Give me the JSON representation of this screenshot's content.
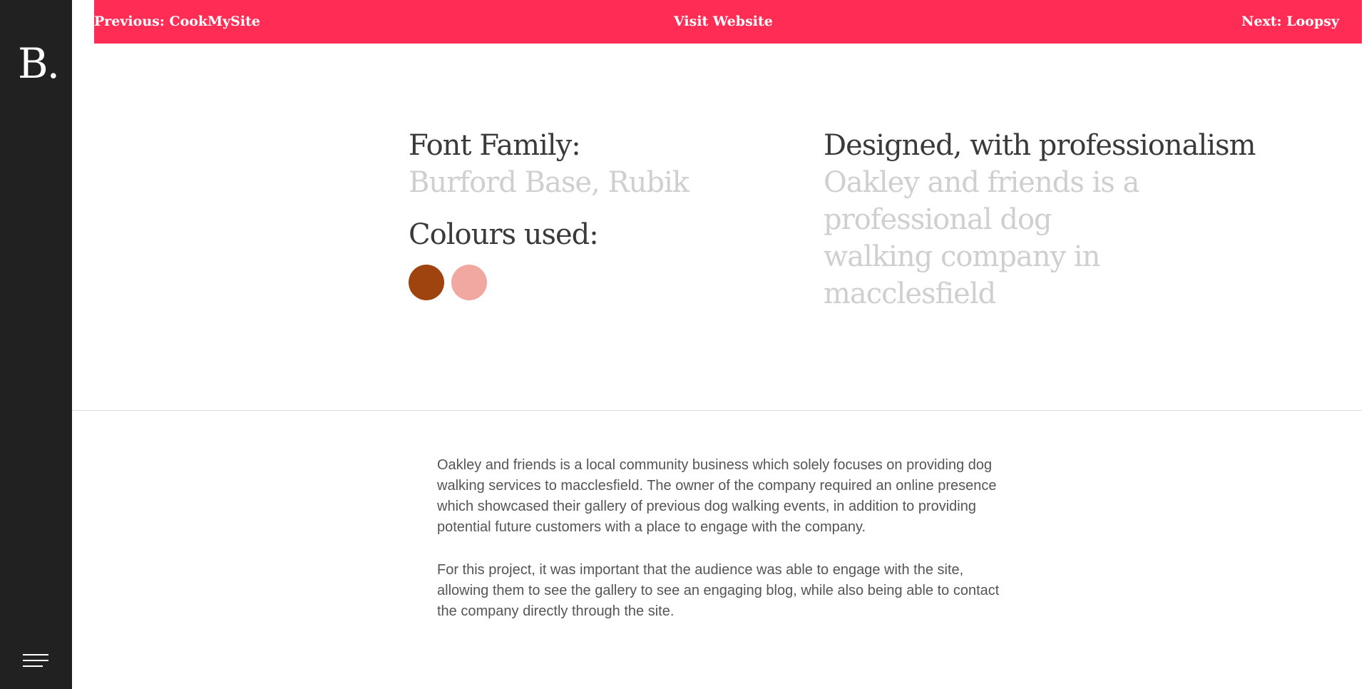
{
  "sidebar": {
    "logo": "B."
  },
  "topbar": {
    "previous_label": "Previous: CookMySite",
    "visit_label": "Visit Website",
    "next_label": "Next: Loopsy"
  },
  "details": {
    "font_family_heading": "Font Family:",
    "font_family_value": "Burford Base, Rubik",
    "colours_heading": "Colours used:",
    "colours": [
      "#a0440f",
      "#f0a8a0"
    ],
    "design_heading": "Designed, with professionalism",
    "design_lines": [
      "Oakley and friends is a",
      "professional dog",
      "walking company in",
      "macclesfield"
    ]
  },
  "description": {
    "paragraph1_lines": [
      "Oakley and friends is a local community business which solely focuses on providing dog",
      "walking services to macclesfield. The owner of the company required an online presence",
      "which showcased their gallery of previous dog walking events, in addition to providing",
      "potential future customers with a place to engage with the company."
    ],
    "paragraph2_lines": [
      "For this project, it was important that the audience was able to engage with the site,",
      "allowing them to see the gallery to see an engaging blog, while also being able to contact",
      "the company directly through the site."
    ]
  }
}
